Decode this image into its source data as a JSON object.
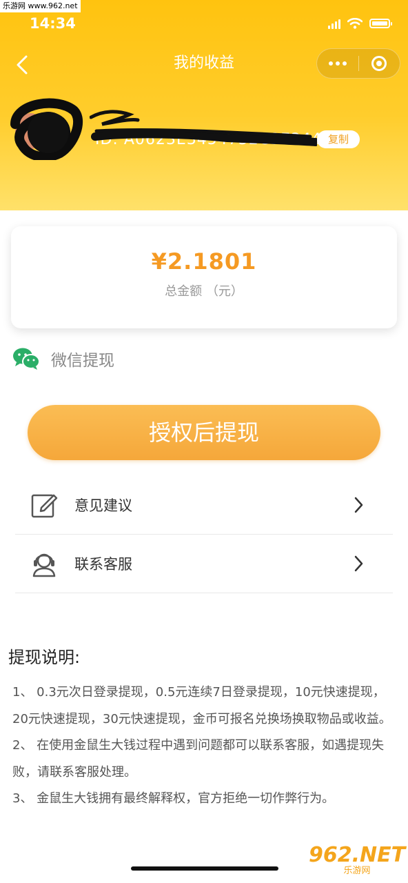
{
  "watermark": {
    "top_text": "乐游网 www.962.net",
    "bottom_main": "962.NET",
    "bottom_sub": "乐游网"
  },
  "status_bar": {
    "time": "14:34"
  },
  "nav": {
    "title": "我的收益"
  },
  "profile": {
    "id_text": "ID: A0623E3454752C3E3441C",
    "copy_label": "复制"
  },
  "balance": {
    "amount": "¥2.1801",
    "label": "总金额 （元）"
  },
  "payout": {
    "method_label": "微信提现",
    "button_label": "授权后提现"
  },
  "menu": [
    {
      "label": "意见建议",
      "icon": "edit-icon"
    },
    {
      "label": "联系客服",
      "icon": "customer-service-icon"
    }
  ],
  "notes": {
    "title": "提现说明:",
    "items": [
      "1、 0.3元次日登录提现，0.5元连续7日登录提现，10元快速提现，20元快速提现，30元快速提现，金币可报名兑换场换取物品或收益。",
      "2、 在使用金鼠生大钱过程中遇到问题都可以联系客服，如遇提现失败，请联系客服处理。",
      "3、 金鼠生大钱拥有最终解释权，官方拒绝一切作弊行为。"
    ]
  },
  "colors": {
    "header": "#ffc30f",
    "accent": "#f59a23",
    "wechat_green": "#2aae67"
  }
}
